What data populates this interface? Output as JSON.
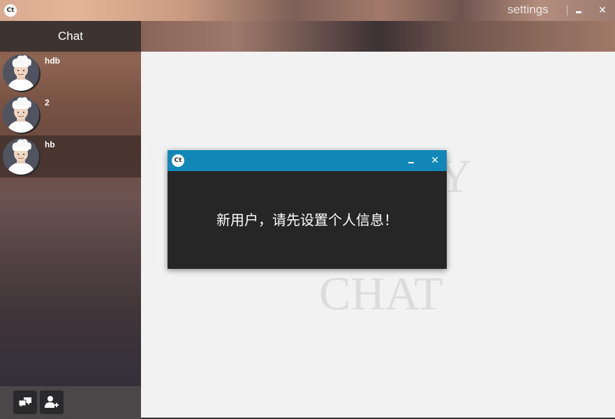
{
  "titlebar": {
    "logo_text": "Ct",
    "settings_label": "settings",
    "minimize_glyph": "",
    "close_glyph": "✕"
  },
  "sidebar": {
    "title": "Chat",
    "contacts": [
      {
        "name": "hdb",
        "selected": false
      },
      {
        "name": "2",
        "selected": false
      },
      {
        "name": "hb",
        "selected": true
      }
    ],
    "footer_icons": [
      "chat-bubbles-icon",
      "add-user-icon"
    ]
  },
  "main": {
    "watermark_lines": [
      "Y",
      "CHAT"
    ]
  },
  "dialog": {
    "logo_text": "Ct",
    "close_glyph": "✕",
    "message": "新用户，请先设置个人信息！"
  },
  "colors": {
    "dialog_titlebar": "#1187b8",
    "dialog_body": "#262626",
    "main_bg": "#f2f2f2",
    "watermark": "#dcdcdc"
  }
}
